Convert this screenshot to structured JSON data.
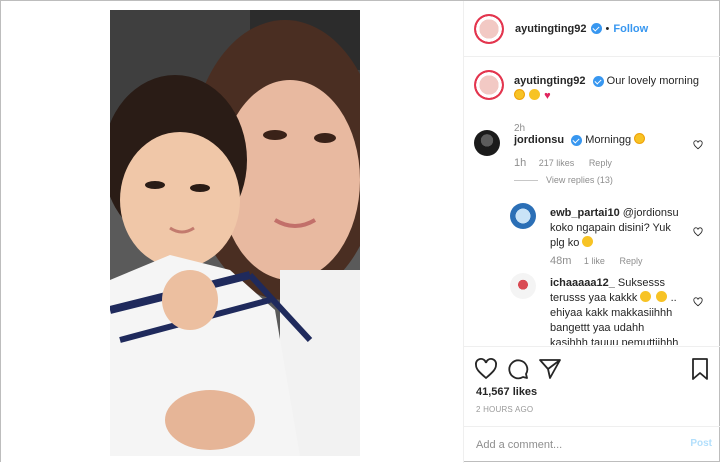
{
  "post": {
    "username": "ayutingting92",
    "follow_label": "Follow",
    "dot": "•",
    "photo_alt_name": "selfie-photo"
  },
  "caption": {
    "username": "ayutingting92",
    "text": "Our lovely morning",
    "time": "2h"
  },
  "comments": [
    {
      "username": "jordionsu",
      "text": "Morningg",
      "time": "1h",
      "likes": "217 likes",
      "reply": "Reply"
    },
    {
      "username": "ewb_partai10",
      "text": "@jordionsu koko ngapain disini? Yuk plg ko",
      "time": "48m",
      "likes": "1 like",
      "reply": "Reply"
    },
    {
      "username": "ichaaaaa12_",
      "text": "Suksesss terusss yaa kakkk",
      "text2": ".. ehiyaa kakk makkasiihhh bangettt yaa udahh kasihhh tauuu pemuttiihhh"
    }
  ],
  "view_replies": "View replies (13)",
  "likes_count": "41,567 likes",
  "post_time": "2 HOURS AGO",
  "add_comment": {
    "placeholder": "Add a comment...",
    "post_label": "Post"
  },
  "icons": {
    "like": "heart-icon",
    "comment": "comment-icon",
    "share": "share-icon",
    "save": "bookmark-icon"
  },
  "colors": {
    "link": "#3897f0",
    "post_disabled": "#b2dffc",
    "muted": "#8e8e8e"
  }
}
